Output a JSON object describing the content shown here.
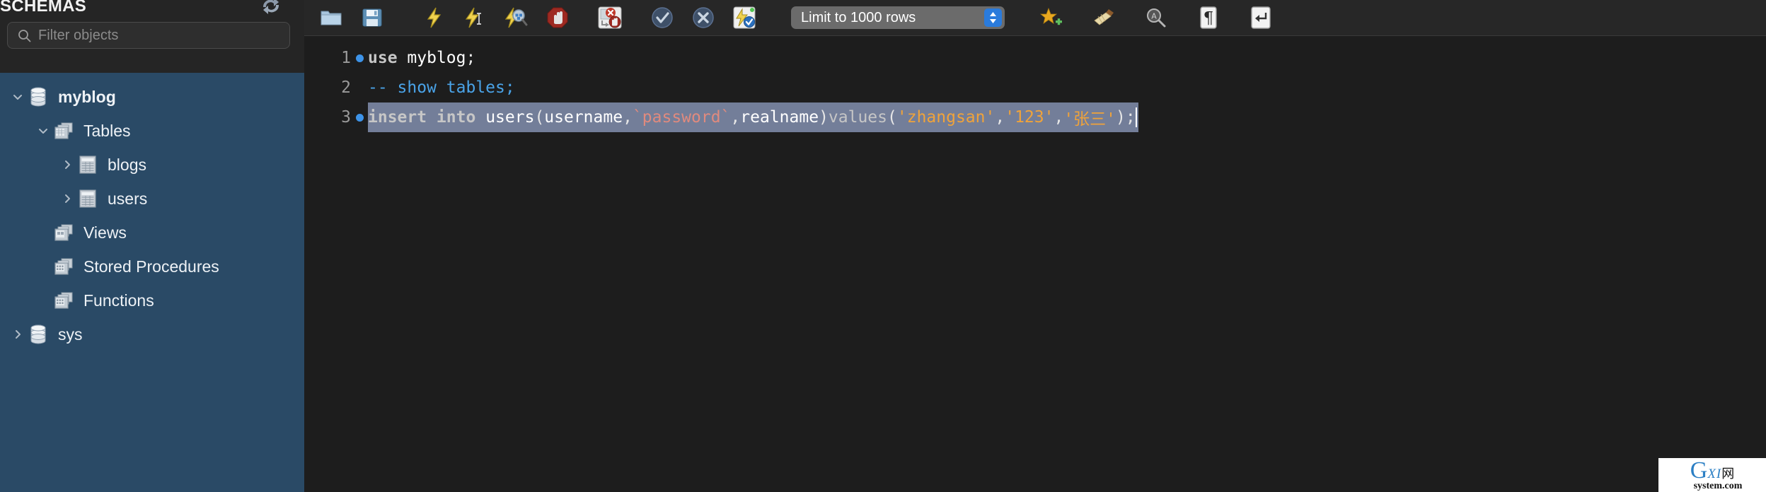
{
  "sidebar": {
    "title": "SCHEMAS",
    "refresh_icon": "refresh-arrows-icon",
    "filter": {
      "placeholder": "Filter objects",
      "value": "",
      "icon": "search-icon"
    },
    "tree": [
      {
        "label": "myblog",
        "icon": "database-icon",
        "depth": 0,
        "twisty": "down",
        "bold": true,
        "selected": false
      },
      {
        "label": "Tables",
        "icon": "tables-icon",
        "depth": 1,
        "twisty": "down",
        "bold": false,
        "selected": false
      },
      {
        "label": "blogs",
        "icon": "table-icon",
        "depth": 2,
        "twisty": "right",
        "bold": false,
        "selected": false
      },
      {
        "label": "users",
        "icon": "table-icon",
        "depth": 2,
        "twisty": "right",
        "bold": false,
        "selected": false
      },
      {
        "label": "Views",
        "icon": "views-icon",
        "depth": 1,
        "twisty": "none",
        "bold": false,
        "selected": false
      },
      {
        "label": "Stored Procedures",
        "icon": "stored-procedures-icon",
        "depth": 1,
        "twisty": "none",
        "bold": false,
        "selected": false
      },
      {
        "label": "Functions",
        "icon": "functions-icon",
        "depth": 1,
        "twisty": "none",
        "bold": false,
        "selected": false
      },
      {
        "label": "sys",
        "icon": "database-icon",
        "depth": 0,
        "twisty": "right",
        "bold": false,
        "selected": false
      }
    ]
  },
  "toolbar": {
    "buttons": [
      {
        "name": "open-sql-script-button",
        "icon": "folder-icon",
        "title": "Open a SQL script file"
      },
      {
        "name": "save-script-button",
        "icon": "floppy-disk-icon",
        "title": "Save script to file"
      },
      {
        "name": "execute-statement-button",
        "icon": "lightning-icon",
        "title": "Execute the selected portion"
      },
      {
        "name": "execute-current-statement-button",
        "icon": "lightning-cursor-icon",
        "title": "Execute the statement under the keyboard cursor"
      },
      {
        "name": "explain-statement-button",
        "icon": "lightning-magnifier-icon",
        "title": "Execute Explain for the statement"
      },
      {
        "name": "stop-button",
        "icon": "stop-hand-icon",
        "title": "Stop the query being executed"
      },
      {
        "name": "toggle-stop-on-error-button",
        "icon": "stop-on-error-icon",
        "title": "Toggle whether execution should stop on errors"
      },
      {
        "name": "commit-button",
        "icon": "check-circle-icon",
        "title": "Commit the current transaction"
      },
      {
        "name": "rollback-button",
        "icon": "x-circle-icon",
        "title": "Rollback the current transaction"
      },
      {
        "name": "toggle-autocommit-button",
        "icon": "autocommit-icon",
        "title": "Toggle autocommit mode"
      }
    ],
    "limit_select": {
      "label": "Limit to 1000 rows",
      "name": "row-limit-select"
    },
    "right_buttons": [
      {
        "name": "new-snippet-button",
        "icon": "star-plus-icon",
        "title": "Save current statement or selection to the snippet list"
      },
      {
        "name": "beautify-query-button",
        "icon": "broom-icon",
        "title": "Beautify/reformat the SQL script"
      },
      {
        "name": "find-button",
        "icon": "magnifier-icon",
        "title": "Find text in this editor"
      },
      {
        "name": "toggle-invisible-characters-button",
        "icon": "pilcrow-icon",
        "title": "Toggle invisible characters"
      },
      {
        "name": "toggle-word-wrap-button",
        "icon": "wrap-arrow-icon",
        "title": "Toggle wrapping of long lines"
      }
    ]
  },
  "editor": {
    "lines": [
      {
        "number": "1",
        "has_marker": true,
        "highlighted": false,
        "tokens": [
          {
            "text": "use",
            "type": "keyword"
          },
          {
            "text": " ",
            "type": "plain"
          },
          {
            "text": "myblog",
            "type": "ident"
          },
          {
            "text": ";",
            "type": "punc"
          }
        ]
      },
      {
        "number": "2",
        "has_marker": false,
        "highlighted": false,
        "tokens": [
          {
            "text": "-- show tables;",
            "type": "comment"
          }
        ]
      },
      {
        "number": "3",
        "has_marker": true,
        "highlighted": true,
        "tokens": [
          {
            "text": "insert into",
            "type": "keyword"
          },
          {
            "text": " ",
            "type": "plain"
          },
          {
            "text": "users",
            "type": "ident"
          },
          {
            "text": "(",
            "type": "punc"
          },
          {
            "text": "username",
            "type": "ident"
          },
          {
            "text": ",",
            "type": "punc"
          },
          {
            "text": "`password`",
            "type": "backtick"
          },
          {
            "text": ",",
            "type": "punc"
          },
          {
            "text": "realname",
            "type": "ident"
          },
          {
            "text": ")",
            "type": "punc"
          },
          {
            "text": "values",
            "type": "func"
          },
          {
            "text": "(",
            "type": "punc"
          },
          {
            "text": "'zhangsan'",
            "type": "string"
          },
          {
            "text": ",",
            "type": "punc"
          },
          {
            "text": "'123'",
            "type": "string"
          },
          {
            "text": ",",
            "type": "punc"
          },
          {
            "text": "'张三'",
            "type": "string"
          },
          {
            "text": ")",
            "type": "punc"
          },
          {
            "text": ";",
            "type": "punc"
          }
        ]
      }
    ]
  },
  "watermark": {
    "g": "G",
    "xi": "XI",
    "cn": "网",
    "domain": "system.com"
  },
  "colors": {
    "sidebar_bg": "#2a4a66",
    "panel_bg": "#252525",
    "toolbar_bg": "#272727",
    "editor_bg": "#1d1d1d",
    "selection": "#737e99",
    "accent_blue": "#3d93e8",
    "string_orange": "#f0a33a",
    "comment_blue": "#4aa3e8",
    "backtick_red": "#e08a7e"
  }
}
